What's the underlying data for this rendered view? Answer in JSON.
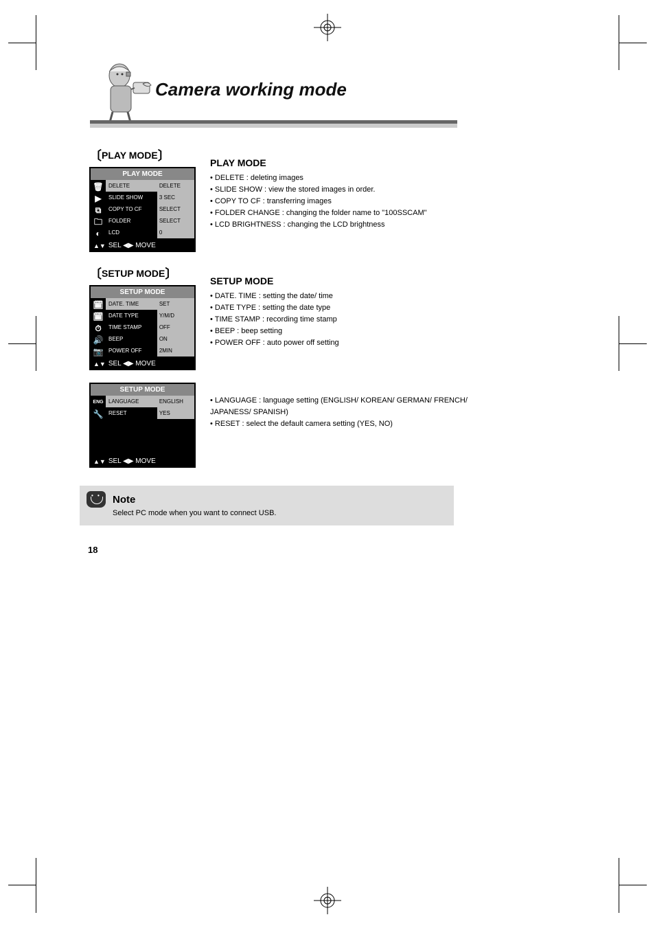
{
  "title": "Camera working mode",
  "page_number": "18",
  "section_play": {
    "label": "PLAY MODE",
    "title": "PLAY MODE",
    "items": [
      "DELETE : deleting images",
      "SLIDE SHOW : view the stored images in order.",
      "COPY TO CF : transferring images",
      "FOLDER CHANGE : changing the folder name to \"100SSCAM\"",
      "LCD BRIGHTNESS : changing the LCD brightness"
    ],
    "screen": {
      "header": "PLAY MODE",
      "rows": [
        {
          "label": "DELETE",
          "value": "DELETE"
        },
        {
          "label": "SLIDE SHOW",
          "value": "3 SEC"
        },
        {
          "label": "COPY TO CF",
          "value": "SELECT"
        },
        {
          "label": "FOLDER",
          "value": "SELECT"
        },
        {
          "label": "LCD",
          "value": "0"
        }
      ],
      "foot": "SEL ◀▶ MOVE"
    }
  },
  "section_setup1": {
    "label": "SETUP MODE",
    "title": "SETUP MODE",
    "items": [
      "DATE. TIME : setting the date/ time",
      "DATE TYPE : setting the date type",
      "TIME STAMP : recording time stamp",
      "BEEP : beep setting",
      "POWER OFF : auto power off setting"
    ],
    "screen": {
      "header": "SETUP MODE",
      "rows": [
        {
          "label": "DATE. TIME",
          "value": "SET"
        },
        {
          "label": "DATE TYPE",
          "value": "Y/M/D"
        },
        {
          "label": "TIME STAMP",
          "value": "OFF"
        },
        {
          "label": "BEEP",
          "value": "ON"
        },
        {
          "label": "POWER OFF",
          "value": "2MIN"
        }
      ],
      "foot": "SEL ◀▶ MOVE"
    }
  },
  "section_setup2": {
    "items": [
      "LANGUAGE : language setting (ENGLISH/ KOREAN/ GERMAN/ FRENCH/ JAPANESS/ SPANISH)",
      "RESET : select the default camera setting (YES, NO)"
    ],
    "screen": {
      "header": "SETUP MODE",
      "rows": [
        {
          "label": "LANGUAGE",
          "value": "ENGLISH"
        },
        {
          "label": "RESET",
          "value": "YES"
        }
      ],
      "foot": "SEL ◀▶ MOVE"
    }
  },
  "note": {
    "title": "Note",
    "body": "Select PC mode when you want to connect USB."
  }
}
